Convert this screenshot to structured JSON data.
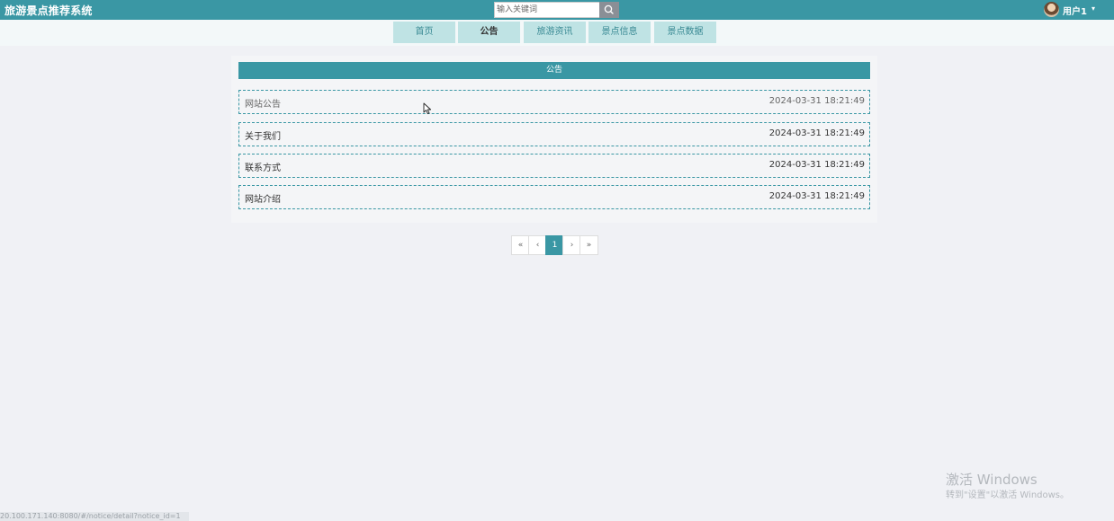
{
  "header": {
    "site_title": "旅游景点推荐系统",
    "search_placeholder": "输入关键词",
    "search_icon": "search-icon",
    "user_name": "用户1",
    "caret_icon": "caret-down-icon"
  },
  "nav": {
    "items": [
      {
        "label": "首页"
      },
      {
        "label": "公告"
      },
      {
        "label": "旅游资讯"
      },
      {
        "label": "景点信息"
      },
      {
        "label": "景点数据"
      }
    ],
    "active": "公告"
  },
  "panel": {
    "title": "公告",
    "rows": [
      {
        "title": "网站公告",
        "time": "2024-03-31 18:21:49"
      },
      {
        "title": "关于我们",
        "time": "2024-03-31 18:21:49"
      },
      {
        "title": "联系方式",
        "time": "2024-03-31 18:21:49"
      },
      {
        "title": "网站介绍",
        "time": "2024-03-31 18:21:49"
      }
    ]
  },
  "pagination": {
    "first": "«",
    "prev": "‹",
    "current": "1",
    "next": "›",
    "last": "»"
  },
  "watermark": {
    "line1": "激活 Windows",
    "line2": "转到\"设置\"以激活 Windows。"
  },
  "status_url": "20.100.171.140:8080/#/notice/detail?notice_id=1",
  "colors": {
    "accent": "#3a97a4",
    "nav_bg": "#bfe3e4",
    "page_bg": "#f0f1f5"
  }
}
